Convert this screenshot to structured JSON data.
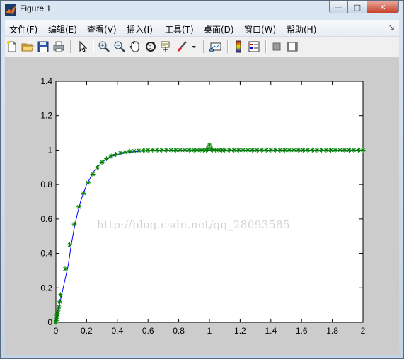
{
  "window": {
    "title": "Figure 1",
    "controls": {
      "minimize": "—",
      "maximize": "□",
      "close": "✕"
    }
  },
  "menu": {
    "items": [
      "文件(F)",
      "编辑(E)",
      "查看(V)",
      "插入(I)",
      "工具(T)",
      "桌面(D)",
      "窗口(W)",
      "帮助(H)"
    ],
    "overflow_glyph": "↘"
  },
  "toolbar": {
    "icons": [
      "new-figure-icon",
      "open-file-icon",
      "save-icon",
      "print-icon",
      "edit-plot-arrow-icon",
      "zoom-in-icon",
      "zoom-out-icon",
      "pan-hand-icon",
      "rotate-3d-icon",
      "data-cursor-icon",
      "brush-icon",
      "brush-dropdown-icon",
      "link-plot-icon",
      "colorbar-icon",
      "legend-icon",
      "hide-plot-tools-icon",
      "show-plot-tools-icon"
    ]
  },
  "watermark": "http://blog.csdn.net/qq_28093585",
  "chart_data": {
    "type": "line",
    "title": "",
    "xlabel": "",
    "ylabel": "",
    "xlim": [
      0,
      2
    ],
    "ylim": [
      0,
      1.4
    ],
    "x_ticks": [
      "0",
      "0.2",
      "0.4",
      "0.6",
      "0.8",
      "1",
      "1.2",
      "1.4",
      "1.6",
      "1.8",
      "2"
    ],
    "y_ticks": [
      "0",
      "0.2",
      "0.4",
      "0.6",
      "0.8",
      "1",
      "1.2",
      "1.4"
    ],
    "grid": false,
    "series": [
      {
        "style": "line",
        "color": "#0000ff",
        "x": [
          0,
          0.02,
          0.04,
          0.06,
          0.08,
          0.1,
          0.12,
          0.14,
          0.16,
          0.18,
          0.2,
          0.25,
          0.3,
          0.35,
          0.4,
          0.5,
          0.6,
          0.8,
          1.0,
          1.2,
          1.5,
          2.0
        ],
        "y": [
          0,
          0.09,
          0.17,
          0.25,
          0.33,
          0.45,
          0.55,
          0.63,
          0.7,
          0.75,
          0.8,
          0.88,
          0.93,
          0.96,
          0.975,
          0.99,
          0.997,
          1.0,
          1.0,
          1.0,
          1.0,
          1.0
        ]
      },
      {
        "style": "markers",
        "marker": "*",
        "color": "#008000",
        "x": [
          0,
          0.002,
          0.004,
          0.006,
          0.008,
          0.01,
          0.015,
          0.02,
          0.025,
          0.03,
          0.06,
          0.09,
          0.12,
          0.15,
          0.18,
          0.21,
          0.24,
          0.27,
          0.3,
          0.33,
          0.36,
          0.39,
          0.42,
          0.45,
          0.48,
          0.51,
          0.54,
          0.57,
          0.6,
          0.63,
          0.66,
          0.69,
          0.72,
          0.75,
          0.78,
          0.81,
          0.84,
          0.87,
          0.9,
          0.92,
          0.94,
          0.96,
          0.98,
          0.99,
          1.0,
          1.01,
          1.02,
          1.04,
          1.06,
          1.08,
          1.1,
          1.13,
          1.16,
          1.19,
          1.22,
          1.25,
          1.28,
          1.31,
          1.34,
          1.37,
          1.4,
          1.43,
          1.46,
          1.49,
          1.52,
          1.55,
          1.58,
          1.61,
          1.64,
          1.67,
          1.7,
          1.73,
          1.76,
          1.79,
          1.82,
          1.85,
          1.88,
          1.91,
          1.94,
          1.97,
          2.0
        ],
        "y": [
          0,
          0.01,
          0.02,
          0.03,
          0.04,
          0.05,
          0.07,
          0.09,
          0.12,
          0.16,
          0.31,
          0.45,
          0.57,
          0.67,
          0.75,
          0.81,
          0.86,
          0.9,
          0.93,
          0.95,
          0.965,
          0.975,
          0.983,
          0.988,
          0.992,
          0.995,
          0.997,
          0.998,
          0.999,
          1.0,
          1.0,
          1.0,
          1.0,
          1.0,
          1.0,
          1.0,
          1.0,
          1.0,
          1.0,
          1.0,
          1.0,
          1.0,
          1.0,
          1.01,
          1.03,
          1.01,
          1.0,
          1.0,
          1.0,
          1.0,
          1.0,
          1.0,
          1.0,
          1.0,
          1.0,
          1.0,
          1.0,
          1.0,
          1.0,
          1.0,
          1.0,
          1.0,
          1.0,
          1.0,
          1.0,
          1.0,
          1.0,
          1.0,
          1.0,
          1.0,
          1.0,
          1.0,
          1.0,
          1.0,
          1.0,
          1.0,
          1.0,
          1.0,
          1.0,
          1.0,
          1.0
        ]
      }
    ]
  }
}
